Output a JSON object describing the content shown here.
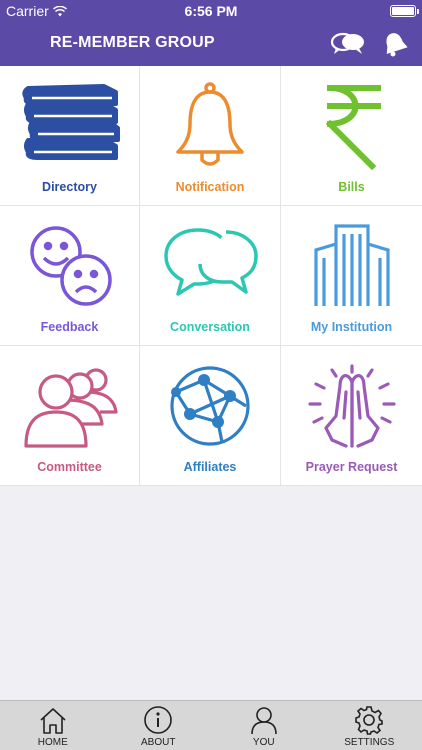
{
  "status_bar": {
    "carrier": "Carrier",
    "time": "6:56 PM"
  },
  "header": {
    "title": "RE-MEMBER GROUP",
    "chat_icon": "chat-bubbles-icon",
    "bell_icon": "bell-icon",
    "bar_color": "#5b4aa6"
  },
  "grid": [
    {
      "label": "Directory",
      "icon": "books-icon",
      "color": "#2c4ea3"
    },
    {
      "label": "Notification",
      "icon": "bell-icon",
      "color": "#ec8c2e"
    },
    {
      "label": "Bills",
      "icon": "rupee-icon",
      "color": "#6fc130"
    },
    {
      "label": "Feedback",
      "icon": "smiley-faces-icon",
      "color": "#7a56d8"
    },
    {
      "label": "Conversation",
      "icon": "speech-bubbles-icon",
      "color": "#2cc7b1"
    },
    {
      "label": "My Institution",
      "icon": "building-icon",
      "color": "#4a9bdc"
    },
    {
      "label": "Committee",
      "icon": "people-icon",
      "color": "#c75a82"
    },
    {
      "label": "Affiliates",
      "icon": "globe-network-icon",
      "color": "#2f7fc4"
    },
    {
      "label": "Prayer Request",
      "icon": "praying-hands-icon",
      "color": "#9b5ab8"
    }
  ],
  "tab_bar": [
    {
      "label": "HOME",
      "icon": "home-icon"
    },
    {
      "label": "ABOUT",
      "icon": "info-icon"
    },
    {
      "label": "YOU",
      "icon": "user-icon"
    },
    {
      "label": "SETTINGS",
      "icon": "gear-icon"
    }
  ]
}
